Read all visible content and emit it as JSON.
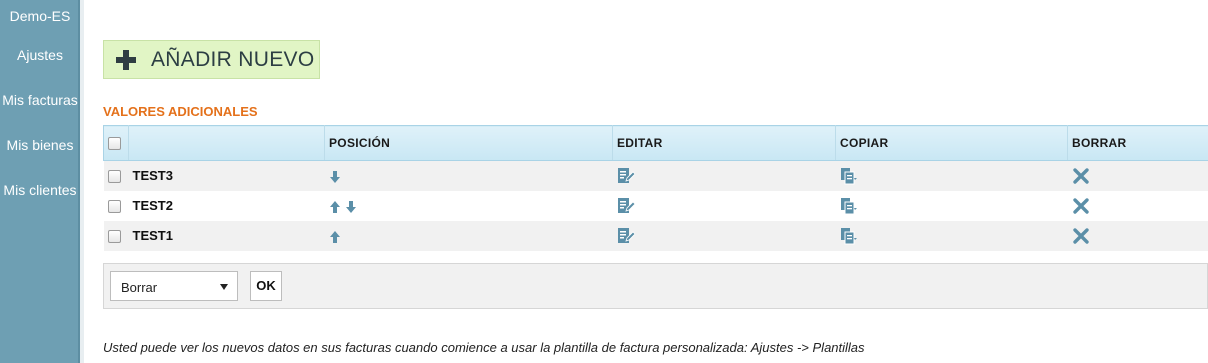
{
  "sidebar": {
    "items": [
      {
        "label": "Demo-ES"
      },
      {
        "label": "Ajustes"
      },
      {
        "label": "Mis facturas"
      },
      {
        "label": "Mis bienes"
      },
      {
        "label": "Mis clientes"
      }
    ]
  },
  "add_button": {
    "label": "AÑADIR NUEVO",
    "icon": "plus-icon"
  },
  "section_title": "VALORES ADICIONALES",
  "table": {
    "columns": [
      "",
      "",
      "POSICIÓN",
      "EDITAR",
      "COPIAR",
      "BORRAR"
    ],
    "rows": [
      {
        "name": "TEST3",
        "position_arrows": [
          "down"
        ]
      },
      {
        "name": "TEST2",
        "position_arrows": [
          "up",
          "down"
        ]
      },
      {
        "name": "TEST1",
        "position_arrows": [
          "up"
        ]
      }
    ]
  },
  "bulk_action": {
    "selected": "Borrar",
    "ok_label": "OK"
  },
  "footnote": "Usted puede ver los nuevos datos en sus facturas cuando comience a usar la plantilla de factura personalizada: Ajustes -> Plantillas",
  "colors": {
    "sidebar_bg": "#6e9fb3",
    "add_button_bg": "#e1f5c5",
    "section_title": "#e4711b",
    "header_bg": "#c8e7f4",
    "icon_color": "#5b8fa8"
  }
}
